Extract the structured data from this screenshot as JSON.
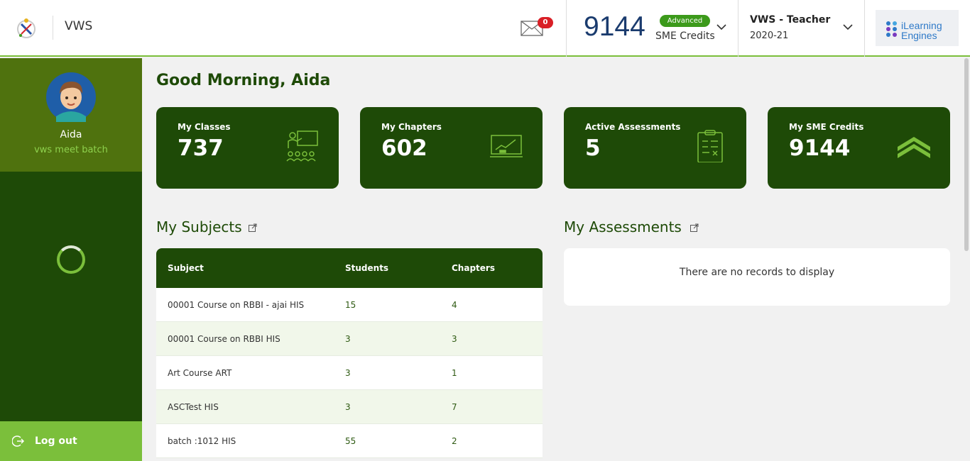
{
  "header": {
    "app_name": "VWS",
    "mail_count": "0",
    "credits_value": "9144",
    "credits_badge": "Advanced",
    "credits_label": "SME Credits",
    "role_title": "VWS - Teacher",
    "role_year": "2020-21",
    "brand_line1": "iLearning",
    "brand_line2": "Engines"
  },
  "sidebar": {
    "user_name": "Aida",
    "user_batch": "vws meet batch",
    "logout_label": "Log out"
  },
  "main": {
    "greeting": "Good Morning, Aida",
    "cards": [
      {
        "label": "My Classes",
        "value": "737",
        "icon": "classroom-icon"
      },
      {
        "label": "My Chapters",
        "value": "602",
        "icon": "chart-monitor-icon"
      },
      {
        "label": "Active Assessments",
        "value": "5",
        "icon": "clipboard-icon"
      },
      {
        "label": "My SME Credits",
        "value": "9144",
        "icon": "rank-chevron-icon"
      }
    ],
    "subjects_title": "My Subjects",
    "assessments_title": "My Assessments",
    "table_headers": [
      "Subject",
      "Students",
      "Chapters"
    ],
    "subjects": [
      {
        "subject": "00001 Course on RBBI - ajai HIS",
        "students": "15",
        "chapters": "4"
      },
      {
        "subject": "00001 Course on RBBI HIS",
        "students": "3",
        "chapters": "3"
      },
      {
        "subject": "Art Course ART",
        "students": "3",
        "chapters": "1"
      },
      {
        "subject": "ASCTest HIS",
        "students": "3",
        "chapters": "7"
      },
      {
        "subject": "batch :1012 HIS",
        "students": "55",
        "chapters": "2"
      }
    ],
    "assessments_empty": "There are no records to display"
  },
  "colors": {
    "dark_green": "#1e4a07",
    "accent_green": "#7bbf3b",
    "profile_green": "#4f720e",
    "badge_red": "#d91f26",
    "credits_blue": "#1a3b6e"
  }
}
